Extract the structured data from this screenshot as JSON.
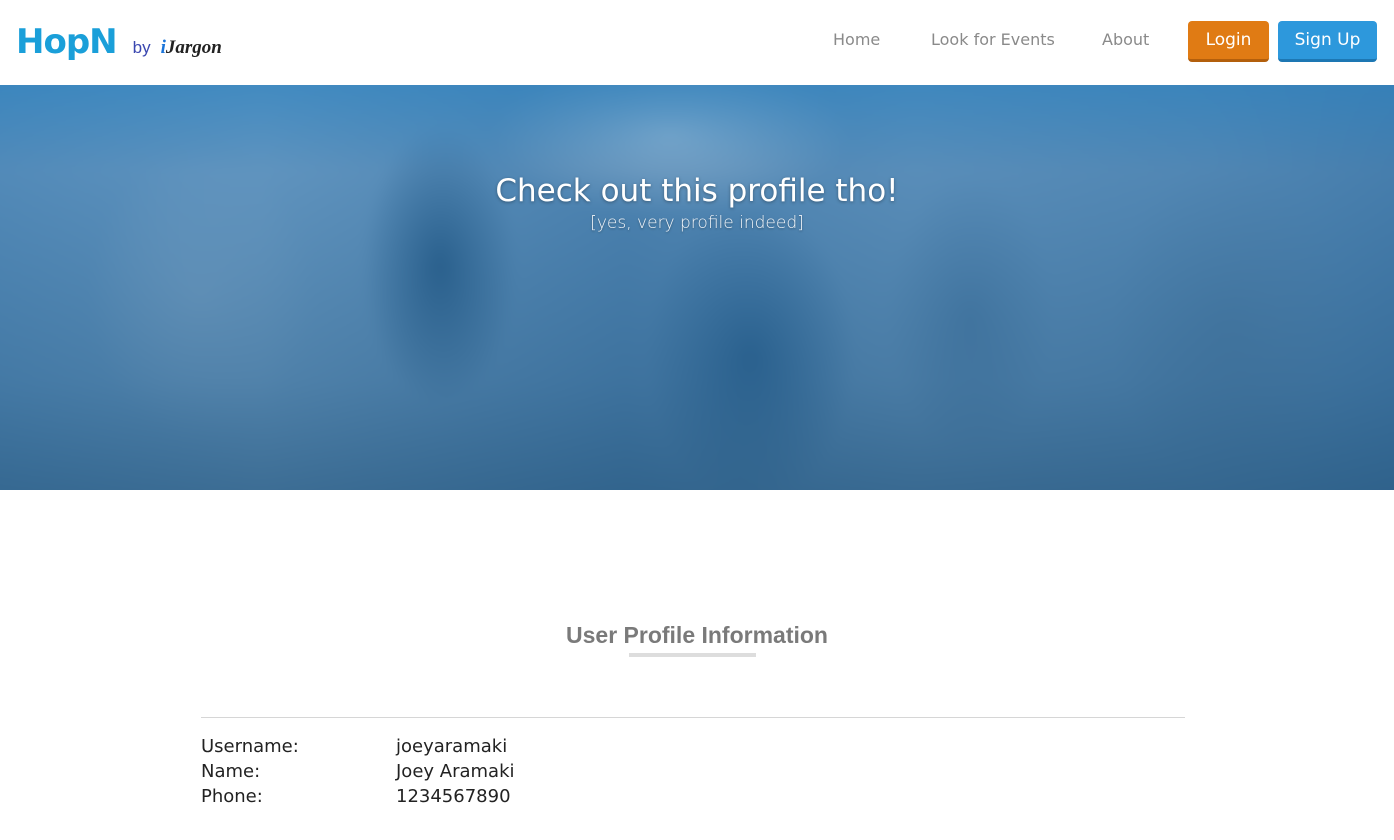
{
  "brand": {
    "logo": "HopN",
    "by": "by",
    "company_i": "i",
    "company_rest": "Jargon"
  },
  "nav": {
    "links": [
      "Home",
      "Look for Events",
      "About"
    ],
    "login_label": "Login",
    "signup_label": "Sign Up"
  },
  "hero": {
    "title": "Check out this profile tho!",
    "subtitle": "[yes, very profile indeed]"
  },
  "profile": {
    "section_title": "User Profile Information",
    "rows": [
      {
        "label": "Username:",
        "value": "joeyaramaki"
      },
      {
        "label": "Name:",
        "value": "Joey Aramaki"
      },
      {
        "label": "Phone:",
        "value": "1234567890"
      }
    ]
  },
  "colors": {
    "brand_blue": "#1a9fd9",
    "login_orange": "#e07b14",
    "signup_blue": "#2d98dc"
  }
}
